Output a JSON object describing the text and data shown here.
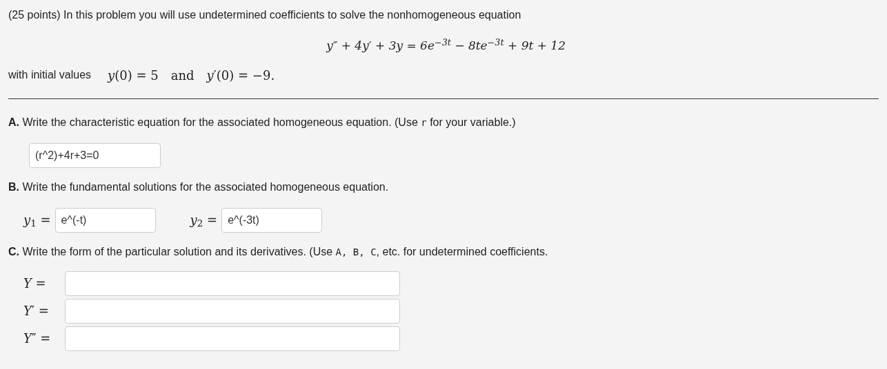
{
  "intro": "(25 points) In this problem you will use undetermined coefficients to solve the nonhomogeneous equation",
  "equation": "y″ + 4y′ + 3y = 6e$^{−3t}$ − 8te$^{−3t}$ + 9t + 12",
  "initial": {
    "label": "with initial values",
    "conditions": [
      "*y*(0) = 5",
      "and",
      "*y*′(0) = −9."
    ]
  },
  "parts": [
    {
      "letter": "A.",
      "prompt": [
        {
          "kind": "plain",
          "text": "Write the characteristic equation for the associated homogeneous equation. (Use "
        },
        {
          "kind": "code",
          "text": "r"
        },
        {
          "kind": "plain",
          "text": " for your variable.)"
        }
      ],
      "kind": "single",
      "fields": [
        {
          "value": "(r^2)+4r+3=0"
        }
      ]
    },
    {
      "letter": "B.",
      "prompt": [
        {
          "kind": "plain",
          "text": "Write the fundamental solutions for the associated homogeneous equation."
        }
      ],
      "kind": "inline",
      "fields": [
        {
          "label": "*y*$_{1}$ =",
          "value": "e^(-t)"
        },
        {
          "label": "*y*$_{2}$ =",
          "value": "e^(-3t)"
        }
      ]
    },
    {
      "letter": "C.",
      "prompt": [
        {
          "kind": "plain",
          "text": "Write the form of the particular solution and its derivatives. (Use "
        },
        {
          "kind": "code",
          "text": "A, B, C"
        },
        {
          "kind": "plain",
          "text": ", etc. for undetermined coefficients."
        }
      ],
      "kind": "stacked",
      "fields": [
        {
          "label": "*Y* ="
        },
        {
          "label": "*Y*′ ="
        },
        {
          "label": "*Y*″ ="
        }
      ]
    }
  ]
}
